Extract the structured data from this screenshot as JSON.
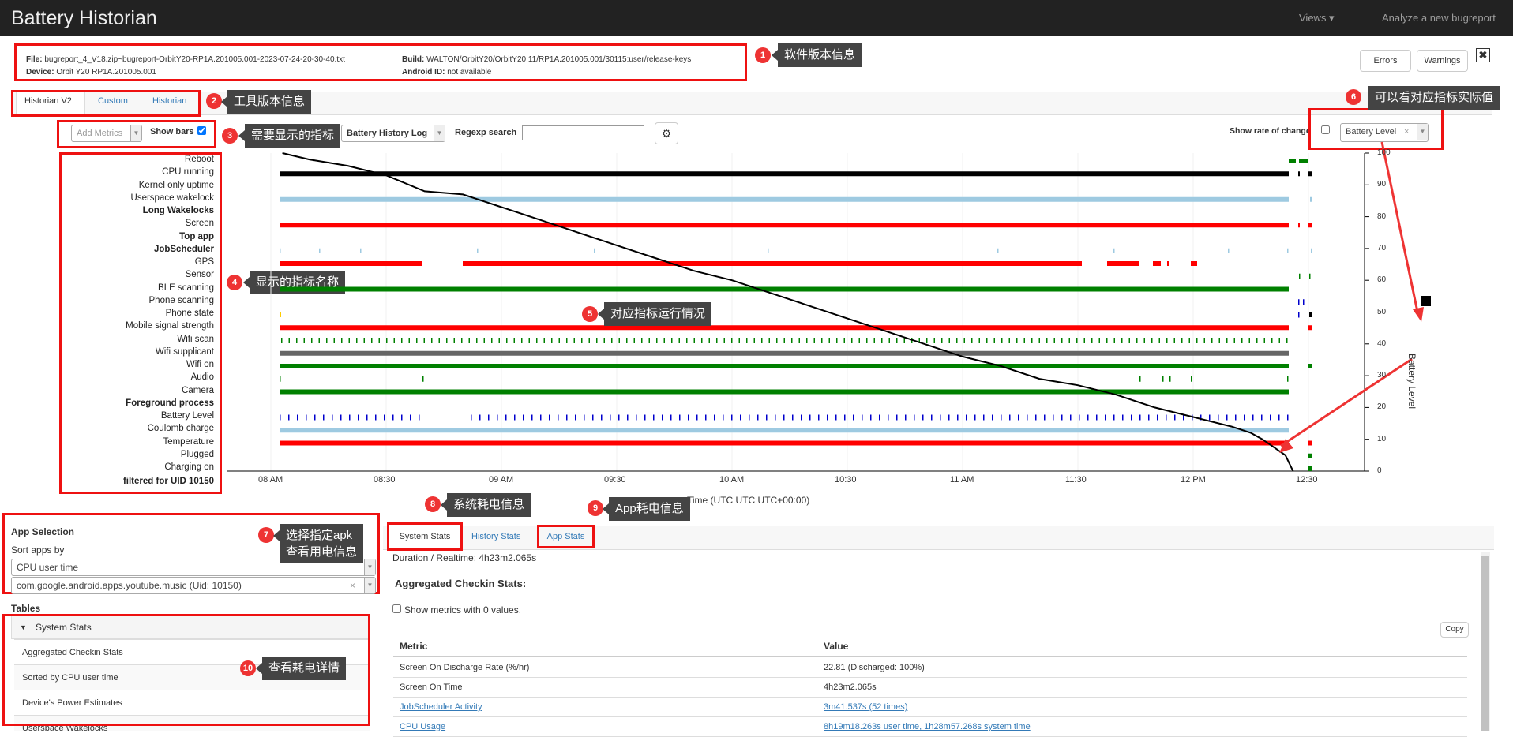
{
  "app": {
    "title": "Battery Historian",
    "nav_views": "Views ▾",
    "nav_analyze": "Analyze a new bugreport"
  },
  "fileinfo": {
    "file_label": "File:",
    "file_value": "bugreport_4_V18.zip~bugreport-OrbitY20-RP1A.201005.001-2023-07-24-20-30-40.txt",
    "device_label": "Device:",
    "device_value": "Orbit Y20 RP1A.201005.001",
    "build_label": "Build:",
    "build_value": "WALTON/OrbitY20/OrbitY20:11/RP1A.201005.001/30115:user/release-keys",
    "android_id_label": "Android ID:",
    "android_id_value": "not available"
  },
  "buttons": {
    "errors": "Errors",
    "warnings": "Warnings",
    "close": "✖"
  },
  "tabs": {
    "t1": "Historian V2",
    "t2": "Custom",
    "t3": "Historian"
  },
  "controls": {
    "add_metrics": "Add Metrics",
    "show_bars": "Show bars",
    "history_log": "Battery History Log",
    "regexp_label": "Regexp search",
    "regexp_value": "",
    "rate_of_change": "Show rate of change",
    "battery_level_select": "Battery Level",
    "select_clear": "×"
  },
  "annotations": {
    "a1": "软件版本信息",
    "a2": "工具版本信息",
    "a3": "需要显示的指标",
    "a4": "显示的指标名称",
    "a5": "对应指标运行情况",
    "a6": "可以看对应指标实际值",
    "a7_line1": "选择指定apk",
    "a7_line2": "查看用电信息",
    "a8": "系统耗电信息",
    "a9": "App耗电信息",
    "a10": "查看耗电详情",
    "n1": "1",
    "n2": "2",
    "n3": "3",
    "n4": "4",
    "n5": "5",
    "n6": "6",
    "n7": "7",
    "n8": "8",
    "n9": "9",
    "n10": "10"
  },
  "metrics": [
    {
      "label": "Reboot",
      "bold": false
    },
    {
      "label": "CPU running",
      "bold": false
    },
    {
      "label": "Kernel only uptime",
      "bold": false
    },
    {
      "label": "Userspace wakelock",
      "bold": false
    },
    {
      "label": "Long Wakelocks",
      "bold": true
    },
    {
      "label": "Screen",
      "bold": false
    },
    {
      "label": "Top app",
      "bold": true
    },
    {
      "label": "JobScheduler",
      "bold": true
    },
    {
      "label": "GPS",
      "bold": false
    },
    {
      "label": "Sensor",
      "bold": false
    },
    {
      "label": "BLE scanning",
      "bold": false
    },
    {
      "label": "Phone scanning",
      "bold": false
    },
    {
      "label": "Phone state",
      "bold": false
    },
    {
      "label": "Mobile signal strength",
      "bold": false
    },
    {
      "label": "Wifi scan",
      "bold": false
    },
    {
      "label": "Wifi supplicant",
      "bold": false
    },
    {
      "label": "Wifi on",
      "bold": false
    },
    {
      "label": "Audio",
      "bold": false
    },
    {
      "label": "Camera",
      "bold": false
    },
    {
      "label": "Foreground process",
      "bold": true
    },
    {
      "label": "Battery Level",
      "bold": false
    },
    {
      "label": "Coulomb charge",
      "bold": false
    },
    {
      "label": "Temperature",
      "bold": false
    },
    {
      "label": "Plugged",
      "bold": false
    },
    {
      "label": "Charging on",
      "bold": false
    }
  ],
  "filtered_label": "filtered for UID 10150",
  "chart_data": {
    "type": "line",
    "xlabel": "Time (UTC UTC UTC+00:00)",
    "ylabel": "Battery Level",
    "x_ticks": [
      "08 AM",
      "08:30",
      "09 AM",
      "09:30",
      "10 AM",
      "10:30",
      "11 AM",
      "11:30",
      "12 PM",
      "12:30"
    ],
    "y_ticks": [
      "100",
      "90",
      "80",
      "70",
      "60",
      "50",
      "40",
      "30",
      "20",
      "10",
      "0"
    ],
    "ylim": [
      0,
      100
    ],
    "series": [
      {
        "name": "Battery Level",
        "x": [
          "08:03",
          "08:10",
          "08:20",
          "08:30",
          "08:40",
          "08:50",
          "09:00",
          "09:10",
          "09:20",
          "09:30",
          "09:40",
          "09:50",
          "10:00",
          "10:10",
          "10:20",
          "10:30",
          "10:40",
          "10:50",
          "11:00",
          "11:10",
          "11:20",
          "11:30",
          "11:40",
          "11:50",
          "12:00",
          "12:10",
          "12:15",
          "12:18",
          "12:24",
          "12:26"
        ],
        "values": [
          100,
          98,
          96,
          93,
          88,
          87,
          83,
          79,
          75,
          71,
          67,
          63,
          60,
          56,
          52,
          48,
          44,
          40,
          36,
          33,
          29,
          27,
          24,
          20,
          17,
          14,
          12,
          10,
          5,
          0
        ]
      }
    ],
    "colors": {
      "line": "#000000",
      "red": "#ff0000",
      "green": "#008000",
      "blue": "#0000cc",
      "lightblue": "#9ecae1",
      "gray": "#666666"
    }
  },
  "app_selection": {
    "title": "App Selection",
    "sort_label": "Sort apps by",
    "sort_value": "CPU user time",
    "app_value": "com.google.android.apps.youtube.music (Uid: 10150)",
    "tables_label": "Tables",
    "section": "System Stats",
    "rows": [
      "Aggregated Checkin Stats",
      "Sorted by CPU user time",
      "Device's Power Estimates",
      "Userspace Wakelocks"
    ]
  },
  "stats": {
    "tab_system": "System Stats",
    "tab_history": "History Stats",
    "tab_app": "App Stats",
    "duration": "Duration / Realtime: 4h23m2.065s",
    "aggregated_title": "Aggregated Checkin Stats:",
    "show_zero": "Show metrics with 0 values.",
    "copy": "Copy",
    "col_metric": "Metric",
    "col_value": "Value",
    "rows": [
      {
        "metric": "Screen On Discharge Rate (%/hr)",
        "value": "22.81 (Discharged: 100%)",
        "link": false
      },
      {
        "metric": "Screen On Time",
        "value": "4h23m2.065s",
        "link": false
      },
      {
        "metric": "JobScheduler Activity",
        "value": "3m41.537s (52 times)",
        "link": true
      },
      {
        "metric": "CPU Usage",
        "value": "8h19m18.263s user time, 1h28m57.268s system time",
        "link": true
      }
    ]
  }
}
